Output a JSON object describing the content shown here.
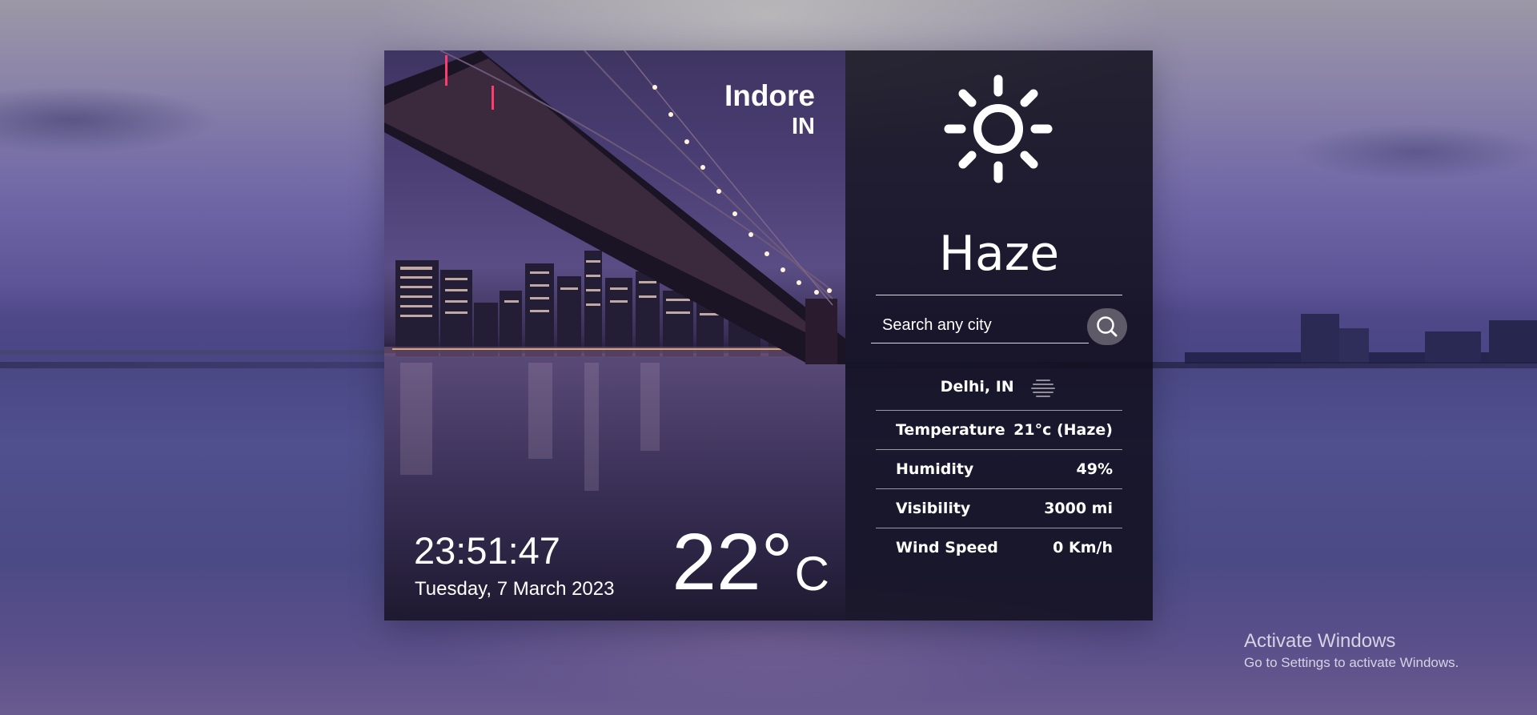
{
  "location_card": {
    "city": "Indore",
    "country": "IN",
    "time": "23:51:47",
    "date": "Tuesday, 7 March 2023",
    "temperature": "22",
    "degree_symbol": "°",
    "unit": "C"
  },
  "weather_panel": {
    "condition_icon": "sun-icon",
    "condition": "Haze",
    "search": {
      "placeholder": "Search any city",
      "value": "",
      "button_icon": "search-icon"
    },
    "result_location": "Delhi, IN",
    "result_icon": "haze-icon",
    "details": [
      {
        "label": "Temperature",
        "value": "21°c (Haze)"
      },
      {
        "label": "Humidity",
        "value": "49%"
      },
      {
        "label": "Visibility",
        "value": "3000 mi"
      },
      {
        "label": "Wind Speed",
        "value": "0 Km/h"
      }
    ]
  },
  "os_watermark": {
    "title": "Activate Windows",
    "subtitle": "Go to Settings to activate Windows."
  },
  "colors": {
    "panel_bg": "#100d1a",
    "text": "#ffffff",
    "search_button": "#5e5a68"
  }
}
